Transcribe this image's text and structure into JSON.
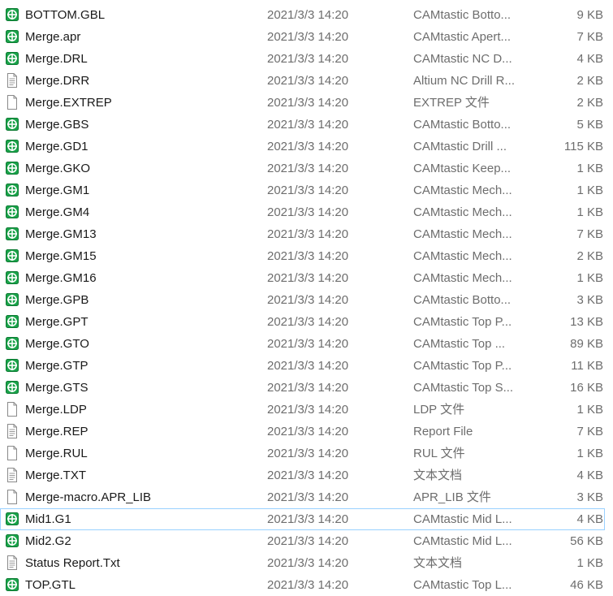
{
  "files": [
    {
      "name": "BOTTOM.GBL",
      "date": "2021/3/3 14:20",
      "type": "CAMtastic Botto...",
      "size": "9 KB",
      "icon": "camtastic-icon"
    },
    {
      "name": "Merge.apr",
      "date": "2021/3/3 14:20",
      "type": "CAMtastic Apert...",
      "size": "7 KB",
      "icon": "camtastic-icon"
    },
    {
      "name": "Merge.DRL",
      "date": "2021/3/3 14:20",
      "type": "CAMtastic NC D...",
      "size": "4 KB",
      "icon": "camtastic-icon"
    },
    {
      "name": "Merge.DRR",
      "date": "2021/3/3 14:20",
      "type": "Altium NC Drill R...",
      "size": "2 KB",
      "icon": "text-file-icon"
    },
    {
      "name": "Merge.EXTREP",
      "date": "2021/3/3 14:20",
      "type": "EXTREP 文件",
      "size": "2 KB",
      "icon": "blank-file-icon"
    },
    {
      "name": "Merge.GBS",
      "date": "2021/3/3 14:20",
      "type": "CAMtastic Botto...",
      "size": "5 KB",
      "icon": "camtastic-icon"
    },
    {
      "name": "Merge.GD1",
      "date": "2021/3/3 14:20",
      "type": "CAMtastic Drill ...",
      "size": "115 KB",
      "icon": "camtastic-icon"
    },
    {
      "name": "Merge.GKO",
      "date": "2021/3/3 14:20",
      "type": "CAMtastic Keep...",
      "size": "1 KB",
      "icon": "camtastic-icon"
    },
    {
      "name": "Merge.GM1",
      "date": "2021/3/3 14:20",
      "type": "CAMtastic Mech...",
      "size": "1 KB",
      "icon": "camtastic-icon"
    },
    {
      "name": "Merge.GM4",
      "date": "2021/3/3 14:20",
      "type": "CAMtastic Mech...",
      "size": "1 KB",
      "icon": "camtastic-icon"
    },
    {
      "name": "Merge.GM13",
      "date": "2021/3/3 14:20",
      "type": "CAMtastic Mech...",
      "size": "7 KB",
      "icon": "camtastic-icon"
    },
    {
      "name": "Merge.GM15",
      "date": "2021/3/3 14:20",
      "type": "CAMtastic Mech...",
      "size": "2 KB",
      "icon": "camtastic-icon"
    },
    {
      "name": "Merge.GM16",
      "date": "2021/3/3 14:20",
      "type": "CAMtastic Mech...",
      "size": "1 KB",
      "icon": "camtastic-icon"
    },
    {
      "name": "Merge.GPB",
      "date": "2021/3/3 14:20",
      "type": "CAMtastic Botto...",
      "size": "3 KB",
      "icon": "camtastic-icon"
    },
    {
      "name": "Merge.GPT",
      "date": "2021/3/3 14:20",
      "type": "CAMtastic Top P...",
      "size": "13 KB",
      "icon": "camtastic-icon"
    },
    {
      "name": "Merge.GTO",
      "date": "2021/3/3 14:20",
      "type": "CAMtastic Top ...",
      "size": "89 KB",
      "icon": "camtastic-icon"
    },
    {
      "name": "Merge.GTP",
      "date": "2021/3/3 14:20",
      "type": "CAMtastic Top P...",
      "size": "11 KB",
      "icon": "camtastic-icon"
    },
    {
      "name": "Merge.GTS",
      "date": "2021/3/3 14:20",
      "type": "CAMtastic Top S...",
      "size": "16 KB",
      "icon": "camtastic-icon"
    },
    {
      "name": "Merge.LDP",
      "date": "2021/3/3 14:20",
      "type": "LDP 文件",
      "size": "1 KB",
      "icon": "blank-file-icon"
    },
    {
      "name": "Merge.REP",
      "date": "2021/3/3 14:20",
      "type": "Report File",
      "size": "7 KB",
      "icon": "text-file-icon"
    },
    {
      "name": "Merge.RUL",
      "date": "2021/3/3 14:20",
      "type": "RUL 文件",
      "size": "1 KB",
      "icon": "blank-file-icon"
    },
    {
      "name": "Merge.TXT",
      "date": "2021/3/3 14:20",
      "type": "文本文档",
      "size": "4 KB",
      "icon": "text-file-icon"
    },
    {
      "name": "Merge-macro.APR_LIB",
      "date": "2021/3/3 14:20",
      "type": "APR_LIB 文件",
      "size": "3 KB",
      "icon": "blank-file-icon"
    },
    {
      "name": "Mid1.G1",
      "date": "2021/3/3 14:20",
      "type": "CAMtastic Mid L...",
      "size": "4 KB",
      "icon": "camtastic-icon",
      "selected": true
    },
    {
      "name": "Mid2.G2",
      "date": "2021/3/3 14:20",
      "type": "CAMtastic Mid L...",
      "size": "56 KB",
      "icon": "camtastic-icon"
    },
    {
      "name": "Status Report.Txt",
      "date": "2021/3/3 14:20",
      "type": "文本文档",
      "size": "1 KB",
      "icon": "text-file-icon"
    },
    {
      "name": "TOP.GTL",
      "date": "2021/3/3 14:20",
      "type": "CAMtastic Top L...",
      "size": "46 KB",
      "icon": "camtastic-icon"
    }
  ],
  "colors": {
    "camtastic_green": "#0aa33a",
    "selection_border": "#99d1ff"
  }
}
